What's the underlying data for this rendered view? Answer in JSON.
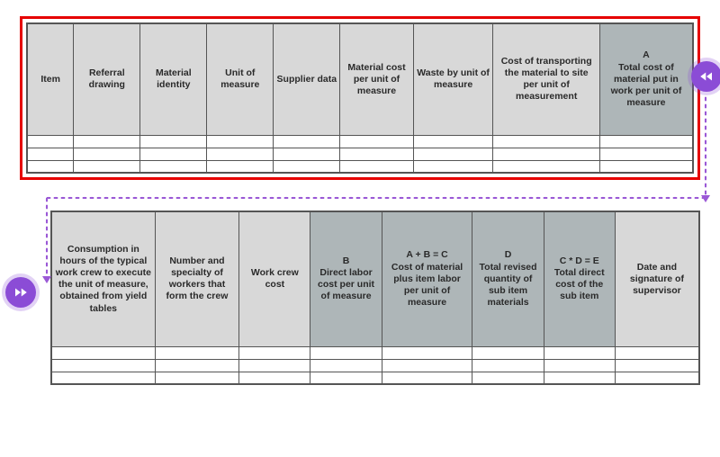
{
  "colors": {
    "accent": "#8b4cd6",
    "highlight_border": "#e60000",
    "shade": "#aeb6b8"
  },
  "icons": {
    "rewind": "rewind-icon",
    "forward": "forward-icon"
  },
  "table1": {
    "headers": [
      {
        "label": "Item",
        "shade": false
      },
      {
        "label": "Referral drawing",
        "shade": false
      },
      {
        "label": "Material identity",
        "shade": false
      },
      {
        "label": "Unit of measure",
        "shade": false
      },
      {
        "label": "Supplier data",
        "shade": false
      },
      {
        "label": "Material cost per unit of measure",
        "shade": false
      },
      {
        "label": "Waste by unit of measure",
        "shade": false
      },
      {
        "label": "Cost of transporting the material to site per unit of measurement",
        "shade": false
      },
      {
        "label": "A\nTotal cost of material put in work per unit of measure",
        "shade": true
      }
    ],
    "blank_rows": 3
  },
  "table2": {
    "headers": [
      {
        "label": "Consumption in hours of the typical work crew to execute the unit of measure, obtained from yield tables",
        "shade": false
      },
      {
        "label": "Number and specialty of workers that form the crew",
        "shade": false
      },
      {
        "label": "Work crew cost",
        "shade": false
      },
      {
        "label": "B\nDirect labor cost per unit of measure",
        "shade": true
      },
      {
        "label": "A + B = C\nCost of material plus item labor per unit of measure",
        "shade": true
      },
      {
        "label": "D\nTotal revised quantity of sub item materials",
        "shade": true
      },
      {
        "label": "C * D = E\nTotal direct cost of the sub item",
        "shade": true
      },
      {
        "label": "Date and signature of supervisor",
        "shade": false
      }
    ],
    "blank_rows": 3
  }
}
